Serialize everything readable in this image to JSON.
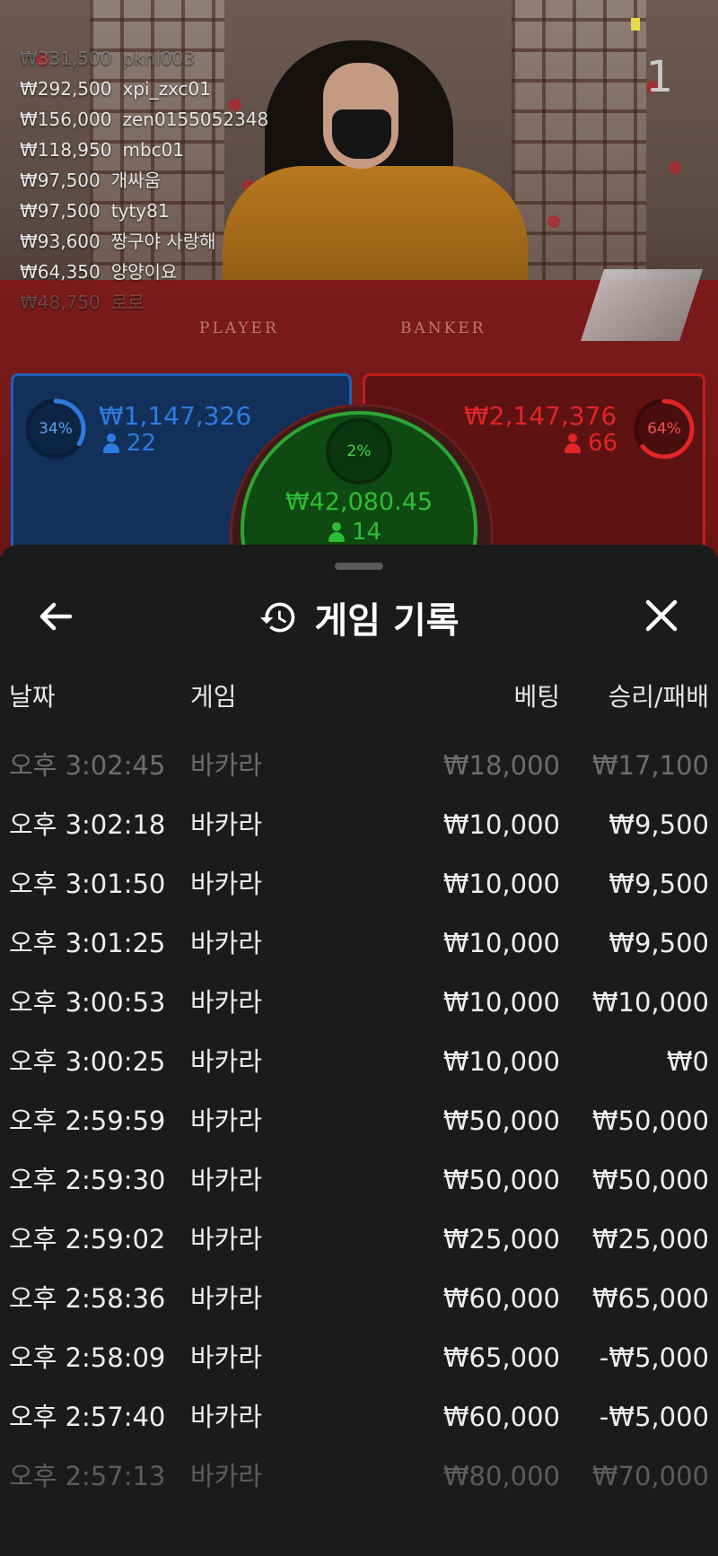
{
  "stream": {
    "top_right_number": "1",
    "felt_labels": {
      "player": "PLAYER",
      "banker": "BANKER"
    },
    "winners": [
      {
        "amount": "₩331,500",
        "name": "pknl003"
      },
      {
        "amount": "₩292,500",
        "name": "xpi_zxc01"
      },
      {
        "amount": "₩156,000",
        "name": "zen0155052348"
      },
      {
        "amount": "₩118,950",
        "name": "mbc01"
      },
      {
        "amount": "₩97,500",
        "name": "개싸움"
      },
      {
        "amount": "₩97,500",
        "name": "tyty81"
      },
      {
        "amount": "₩93,600",
        "name": "짱구야 사랑해"
      },
      {
        "amount": "₩64,350",
        "name": "양양이요"
      },
      {
        "amount": "₩48,750",
        "name": "로로"
      }
    ]
  },
  "bets": {
    "player": {
      "percent": "34%",
      "percent_value": 34,
      "amount": "₩1,147,326",
      "count": "22",
      "color": "#2f7be0"
    },
    "banker": {
      "percent": "64%",
      "percent_value": 64,
      "amount": "₩2,147,376",
      "count": "66",
      "color": "#e02626"
    },
    "tie": {
      "percent": "2%",
      "percent_value": 2,
      "amount": "₩42,080.45",
      "count": "14",
      "color": "#2fbd37"
    }
  },
  "sheet": {
    "title": "게임 기록",
    "icons": {
      "back": "arrow-left-icon",
      "history": "history-icon",
      "close": "close-icon"
    },
    "columns": {
      "date": "날짜",
      "game": "게임",
      "bet": "베팅",
      "result": "승리/패배"
    },
    "rows": [
      {
        "date": "오후 3:02:45",
        "game": "바카라",
        "bet": "₩18,000",
        "result": "₩17,100"
      },
      {
        "date": "오후 3:02:18",
        "game": "바카라",
        "bet": "₩10,000",
        "result": "₩9,500"
      },
      {
        "date": "오후 3:01:50",
        "game": "바카라",
        "bet": "₩10,000",
        "result": "₩9,500"
      },
      {
        "date": "오후 3:01:25",
        "game": "바카라",
        "bet": "₩10,000",
        "result": "₩9,500"
      },
      {
        "date": "오후 3:00:53",
        "game": "바카라",
        "bet": "₩10,000",
        "result": "₩10,000"
      },
      {
        "date": "오후 3:00:25",
        "game": "바카라",
        "bet": "₩10,000",
        "result": "₩0"
      },
      {
        "date": "오후 2:59:59",
        "game": "바카라",
        "bet": "₩50,000",
        "result": "₩50,000"
      },
      {
        "date": "오후 2:59:30",
        "game": "바카라",
        "bet": "₩50,000",
        "result": "₩50,000"
      },
      {
        "date": "오후 2:59:02",
        "game": "바카라",
        "bet": "₩25,000",
        "result": "₩25,000"
      },
      {
        "date": "오후 2:58:36",
        "game": "바카라",
        "bet": "₩60,000",
        "result": "₩65,000"
      },
      {
        "date": "오후 2:58:09",
        "game": "바카라",
        "bet": "₩65,000",
        "result": "-₩5,000"
      },
      {
        "date": "오후 2:57:40",
        "game": "바카라",
        "bet": "₩60,000",
        "result": "-₩5,000"
      },
      {
        "date": "오후 2:57:13",
        "game": "바카라",
        "bet": "₩80,000",
        "result": "₩70,000"
      }
    ]
  }
}
